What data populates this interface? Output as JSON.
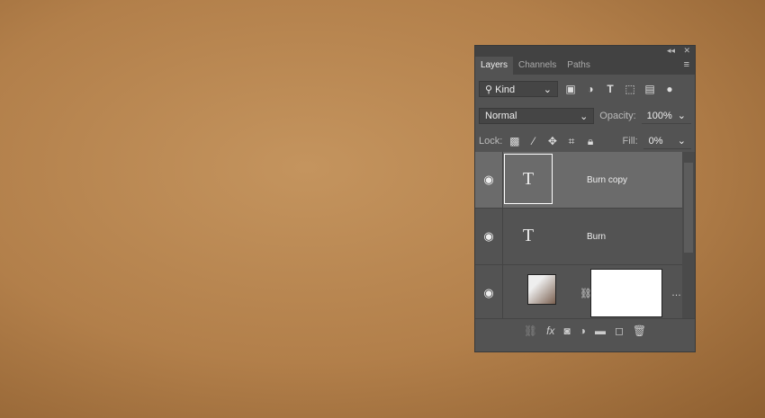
{
  "tabs": [
    "Layers",
    "Channels",
    "Paths"
  ],
  "filter": {
    "label": "Kind"
  },
  "blend": {
    "mode": "Normal",
    "opacity_label": "Opacity:",
    "opacity": "100%"
  },
  "lock": {
    "label": "Lock:",
    "fill_label": "Fill:",
    "fill": "0%"
  },
  "layers": [
    {
      "name": "Burn copy",
      "thumb": "T",
      "selected": true
    },
    {
      "name": "Burn",
      "thumb": "T"
    },
    {
      "name": "",
      "thumb": "gradient"
    }
  ]
}
